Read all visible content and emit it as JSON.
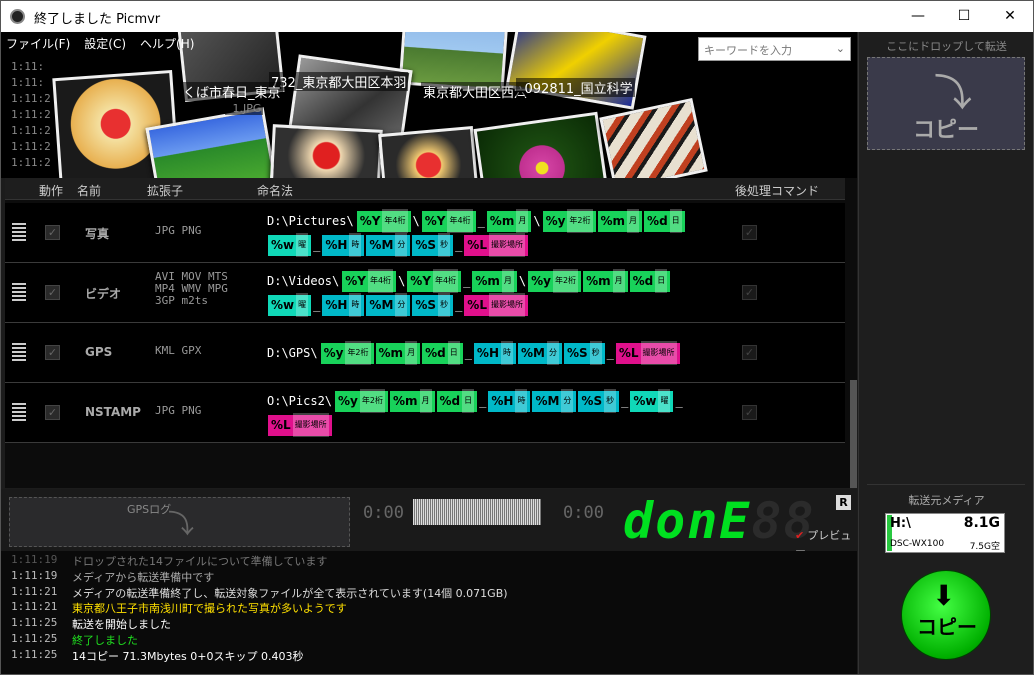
{
  "window": {
    "title": "終了しました Picmvr",
    "min_glyph": "—",
    "max_glyph": "☐",
    "close_glyph": "✕"
  },
  "menu": [
    "ファイル(F)",
    "設定(C)",
    "ヘルプ(H)"
  ],
  "search": {
    "placeholder": "キーワードを入力"
  },
  "collage": {
    "top_log_times": [
      "1:11:",
      "1:11:",
      "1:11:2",
      "1:11:2",
      "1:11:2",
      "1:11:2",
      "1:11:2"
    ],
    "overlay_texts": [
      "732_東京都大田区本羽",
      "東京都大田区西六",
      "_092811_国立科学",
      "くば市春日_東京",
      "_1.JPG"
    ]
  },
  "grid": {
    "headers": {
      "action": "動作",
      "name": "名前",
      "ext": "拡張子",
      "naming": "命名法",
      "post": "後処理コマンド"
    },
    "rows": [
      {
        "name": "写真",
        "ext": [
          "JPG PNG"
        ],
        "path": "D:\\Pictures\\",
        "line1": [
          {
            "t": "%Y",
            "s": "年4桁",
            "c": "date"
          },
          {
            "sep": "\\"
          },
          {
            "t": "%Y",
            "s": "年4桁",
            "c": "date"
          },
          {
            "sep": "_"
          },
          {
            "t": "%m",
            "s": "月",
            "c": "date"
          },
          {
            "sep": "\\"
          },
          {
            "t": "%y",
            "s": "年2桁",
            "c": "date"
          },
          {
            "t": "%m",
            "s": "月",
            "c": "date"
          },
          {
            "t": "%d",
            "s": "日",
            "c": "date"
          }
        ],
        "line2": [
          {
            "t": "%w",
            "s": "曜",
            "c": "week"
          },
          {
            "sep": "_"
          },
          {
            "t": "%H",
            "s": "時",
            "c": "time"
          },
          {
            "t": "%M",
            "s": "分",
            "c": "time"
          },
          {
            "t": "%S",
            "s": "秒",
            "c": "time"
          },
          {
            "sep": "_"
          },
          {
            "t": "%L",
            "s": "撮影場所",
            "c": "loc"
          }
        ]
      },
      {
        "name": "ビデオ",
        "ext": [
          "AVI MOV MTS",
          "MP4 WMV MPG",
          "3GP m2ts"
        ],
        "path": "D:\\Videos\\",
        "line1": [
          {
            "t": "%Y",
            "s": "年4桁",
            "c": "date"
          },
          {
            "sep": "\\"
          },
          {
            "t": "%Y",
            "s": "年4桁",
            "c": "date"
          },
          {
            "sep": "_"
          },
          {
            "t": "%m",
            "s": "月",
            "c": "date"
          },
          {
            "sep": "\\"
          },
          {
            "t": "%y",
            "s": "年2桁",
            "c": "date"
          },
          {
            "t": "%m",
            "s": "月",
            "c": "date"
          },
          {
            "t": "%d",
            "s": "日",
            "c": "date"
          }
        ],
        "line2": [
          {
            "t": "%w",
            "s": "曜",
            "c": "week"
          },
          {
            "sep": "_"
          },
          {
            "t": "%H",
            "s": "時",
            "c": "time"
          },
          {
            "t": "%M",
            "s": "分",
            "c": "time"
          },
          {
            "t": "%S",
            "s": "秒",
            "c": "time"
          },
          {
            "sep": "_"
          },
          {
            "t": "%L",
            "s": "撮影場所",
            "c": "loc"
          }
        ]
      },
      {
        "name": "GPS",
        "ext": [
          "KML GPX"
        ],
        "path": "D:\\GPS\\",
        "line1": [
          {
            "t": "%y",
            "s": "年2桁",
            "c": "date"
          },
          {
            "t": "%m",
            "s": "月",
            "c": "date"
          },
          {
            "t": "%d",
            "s": "日",
            "c": "date"
          },
          {
            "sep": "_"
          },
          {
            "t": "%H",
            "s": "時",
            "c": "time"
          },
          {
            "t": "%M",
            "s": "分",
            "c": "time"
          },
          {
            "t": "%S",
            "s": "秒",
            "c": "time"
          },
          {
            "sep": "_"
          },
          {
            "t": "%L",
            "s": "撮影場所",
            "c": "loc"
          }
        ],
        "line2": []
      },
      {
        "name": "NSTAMP",
        "ext": [
          "JPG PNG"
        ],
        "path": "O:\\Pics2\\",
        "line1": [
          {
            "t": "%y",
            "s": "年2桁",
            "c": "date"
          },
          {
            "t": "%m",
            "s": "月",
            "c": "date"
          },
          {
            "t": "%d",
            "s": "日",
            "c": "date"
          },
          {
            "sep": "_"
          },
          {
            "t": "%H",
            "s": "時",
            "c": "time"
          },
          {
            "t": "%M",
            "s": "分",
            "c": "time"
          },
          {
            "t": "%S",
            "s": "秒",
            "c": "time"
          },
          {
            "sep": "_"
          },
          {
            "t": "%w",
            "s": "曜",
            "c": "week"
          },
          {
            "sep": "_"
          }
        ],
        "line2": [
          {
            "t": "%L",
            "s": "撮影場所",
            "c": "loc"
          }
        ]
      }
    ],
    "add_label": "+"
  },
  "status": {
    "gps_label": "GPSログ",
    "timecode_left": "0:00",
    "timecode_right": "0:00",
    "display_on": "donE",
    "display_off": "88",
    "r_badge": "R",
    "preview_label": "プレビュー"
  },
  "log": [
    {
      "time": "1:11:19",
      "msg": "ドロップされた14ファイルについて準備しています",
      "color": "#777"
    },
    {
      "time": "1:11:19",
      "msg": "メディアから転送準備中です",
      "color": "#aaaaaa"
    },
    {
      "time": "1:11:21",
      "msg": "メディアの転送準備終了し、転送対象ファイルが全て表示されています(14個 0.071GB)",
      "color": "#dddddd"
    },
    {
      "time": "1:11:21",
      "msg": "東京都八王子市南浅川町で撮られた写真が多いようです",
      "color": "#ffe000"
    },
    {
      "time": "1:11:25",
      "msg": "転送を開始しました",
      "color": "#ffffff"
    },
    {
      "time": "1:11:25",
      "msg": "終了しました",
      "color": "#20e020"
    },
    {
      "time": "1:11:25",
      "msg": "14コピー 71.3Mbytes 0+0スキップ 0.403秒",
      "color": "#ffffff"
    }
  ],
  "right": {
    "drop_title": "ここにドロップして転送",
    "drop_label": "コピー",
    "source_title": "転送元メディア",
    "media": {
      "drive": "H:\\",
      "size": "8.1G",
      "name": "DSC-WX100",
      "free": "7.5G空"
    },
    "copy_label": "コピー"
  }
}
